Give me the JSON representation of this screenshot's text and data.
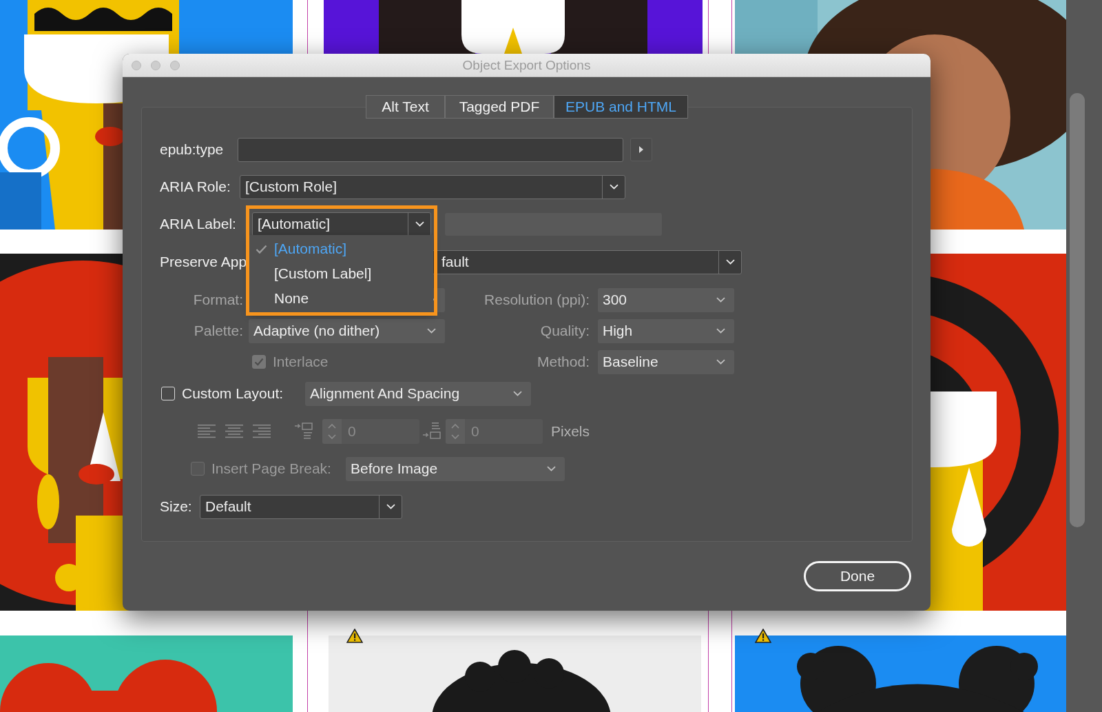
{
  "window": {
    "title": "Object Export Options"
  },
  "tabs": [
    {
      "label": "Alt Text",
      "selected": false
    },
    {
      "label": "Tagged PDF",
      "selected": false
    },
    {
      "label": "EPUB and HTML",
      "selected": true
    }
  ],
  "epub_type": {
    "label": "epub:type"
  },
  "aria_role": {
    "label": "ARIA Role:",
    "value": "[Custom Role]"
  },
  "aria_label": {
    "label": "ARIA Label:",
    "value": "[Automatic]",
    "expanded": true,
    "options": [
      {
        "label": "[Automatic]",
        "selected": true
      },
      {
        "label": "[Custom Label]",
        "selected": false
      },
      {
        "label": "None",
        "selected": false
      }
    ]
  },
  "preserve_appearance": {
    "label": "Preserve App",
    "value": "fault"
  },
  "format": {
    "label": "Format:",
    "disabled": true
  },
  "resolution": {
    "label": "Resolution (ppi):",
    "value": "300",
    "disabled": true
  },
  "palette": {
    "label": "Palette:",
    "value": "Adaptive (no dither)",
    "disabled": true
  },
  "quality": {
    "label": "Quality:",
    "value": "High",
    "disabled": true
  },
  "interlace": {
    "label": "Interlace",
    "checked": true,
    "disabled": true
  },
  "method": {
    "label": "Method:",
    "value": "Baseline",
    "disabled": true
  },
  "custom_layout": {
    "label": "Custom Layout:",
    "checked": false,
    "value": "Alignment And Spacing"
  },
  "spacing": {
    "before": "0",
    "after": "0",
    "unit": "Pixels",
    "disabled": true
  },
  "insert_page_break": {
    "label": "Insert Page Break:",
    "checked": false,
    "disabled": true,
    "value": "Before Image"
  },
  "size": {
    "label": "Size:",
    "value": "Default"
  },
  "done_button": "Done"
}
